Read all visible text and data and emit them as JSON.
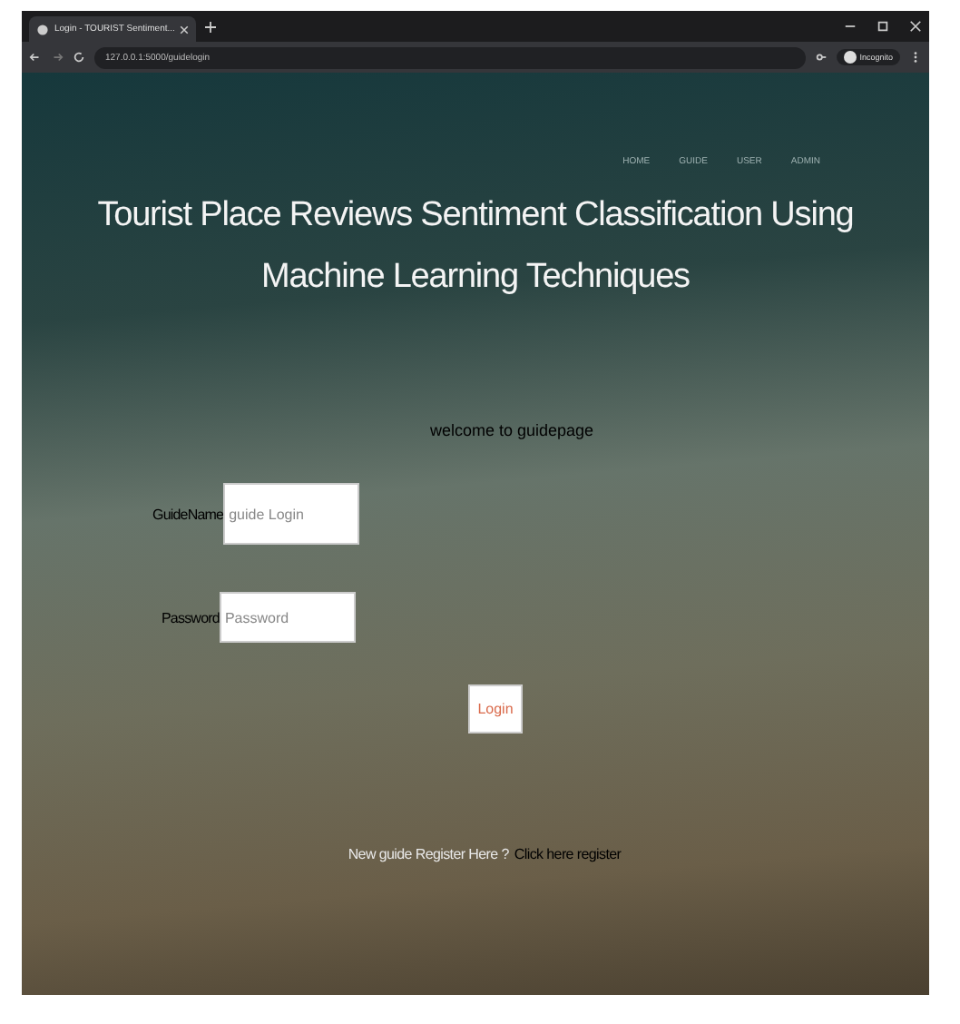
{
  "browser": {
    "tab_title": "Login - TOURIST Sentiment...",
    "address": "127.0.0.1:5000/guidelogin",
    "profile": "Incognito"
  },
  "nav": [
    {
      "label": "HOME"
    },
    {
      "label": "GUIDE"
    },
    {
      "label": "USER"
    },
    {
      "label": "ADMIN"
    }
  ],
  "title": "Tourist Place Reviews Sentiment Classification Using Machine Learning Techniques",
  "welcome": "welcome to guidepage",
  "form": {
    "fields": [
      {
        "label": "GuideName",
        "placeholder": "guide Login"
      },
      {
        "label": "Password",
        "placeholder": "Password"
      }
    ],
    "submit": "Login"
  },
  "register": {
    "text": "New guide Register Here ?",
    "link": "Click here register"
  }
}
